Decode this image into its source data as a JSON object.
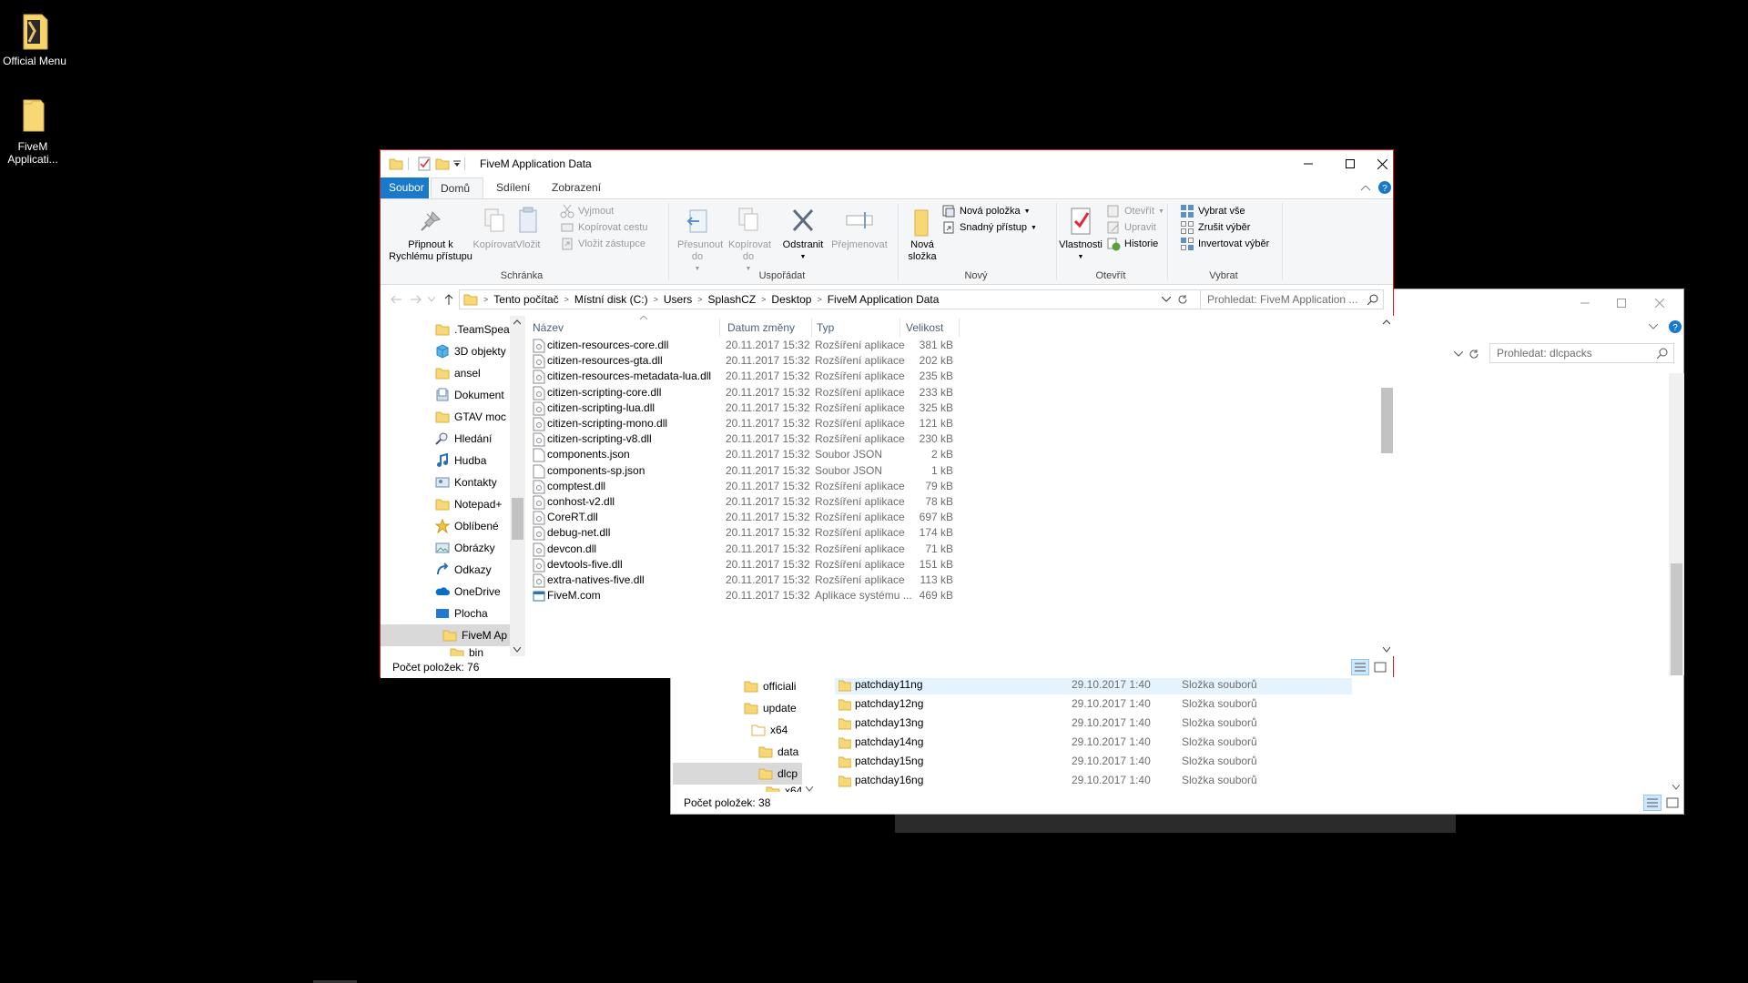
{
  "desktop": {
    "icons": [
      {
        "label": "Official Menu",
        "icon": "folder-doc-icon"
      },
      {
        "label": "FiveM Applicati...",
        "icon": "folder-icon"
      }
    ]
  },
  "front_window": {
    "title": "FiveM Application Data",
    "tabs": {
      "file": "Soubor",
      "home": "Domů",
      "share": "Sdílení",
      "view": "Zobrazení"
    },
    "ribbon": {
      "pin": "Připnout k Rychlému přístupu",
      "copy": "Kopírovat",
      "paste": "Vložit",
      "cut": "Vyjmout",
      "copy_path": "Kopírovat cestu",
      "paste_shortcut": "Vložit zástupce",
      "group_clipboard": "Schránka",
      "move_to": "Přesunout do",
      "copy_to": "Kopírovat do",
      "delete": "Odstranit",
      "rename": "Přejmenovat",
      "group_organize": "Uspořádat",
      "new_folder": "Nová složka",
      "new_item": "Nová položka",
      "easy_access": "Snadný přístup",
      "group_new": "Nový",
      "properties": "Vlastnosti",
      "open": "Otevřít",
      "edit": "Upravit",
      "history": "Historie",
      "group_open": "Otevřít",
      "select_all": "Vybrat vše",
      "select_none": "Zrušit výběr",
      "invert_selection": "Invertovat výběr",
      "group_select": "Vybrat"
    },
    "breadcrumb": [
      "Tento počítač",
      "Místní disk (C:)",
      "Users",
      "SplashCZ",
      "Desktop",
      "FiveM Application Data"
    ],
    "search_placeholder": "Prohledat: FiveM Application ...",
    "nav": [
      {
        "label": ".TeamSpea",
        "icon": "folder-icon"
      },
      {
        "label": "3D objekty",
        "icon": "cube-icon"
      },
      {
        "label": "ansel",
        "icon": "folder-icon"
      },
      {
        "label": "Dokument",
        "icon": "documents-icon"
      },
      {
        "label": "GTAV moc",
        "icon": "folder-icon"
      },
      {
        "label": "Hledání",
        "icon": "search-icon"
      },
      {
        "label": "Hudba",
        "icon": "music-icon"
      },
      {
        "label": "Kontakty",
        "icon": "contacts-icon"
      },
      {
        "label": "Notepad+",
        "icon": "folder-icon"
      },
      {
        "label": "Oblíbené",
        "icon": "star-icon"
      },
      {
        "label": "Obrázky",
        "icon": "pictures-icon"
      },
      {
        "label": "Odkazy",
        "icon": "links-icon"
      },
      {
        "label": "OneDrive",
        "icon": "cloud-icon"
      },
      {
        "label": "Plocha",
        "icon": "desktop-icon"
      },
      {
        "label": "FiveM Ap",
        "icon": "folder-icon"
      },
      {
        "label": "bin",
        "icon": "folder-icon"
      }
    ],
    "columns": {
      "name": "Název",
      "date": "Datum změny",
      "type": "Typ",
      "size": "Velikost"
    },
    "files": [
      {
        "name": "citizen-resources-core.dll",
        "date": "20.11.2017 15:32",
        "type": "Rozšíření aplikace",
        "size": "381 kB",
        "icon": "dll-icon"
      },
      {
        "name": "citizen-resources-gta.dll",
        "date": "20.11.2017 15:32",
        "type": "Rozšíření aplikace",
        "size": "202 kB",
        "icon": "dll-icon"
      },
      {
        "name": "citizen-resources-metadata-lua.dll",
        "date": "20.11.2017 15:32",
        "type": "Rozšíření aplikace",
        "size": "235 kB",
        "icon": "dll-icon"
      },
      {
        "name": "citizen-scripting-core.dll",
        "date": "20.11.2017 15:32",
        "type": "Rozšíření aplikace",
        "size": "233 kB",
        "icon": "dll-icon"
      },
      {
        "name": "citizen-scripting-lua.dll",
        "date": "20.11.2017 15:32",
        "type": "Rozšíření aplikace",
        "size": "325 kB",
        "icon": "dll-icon"
      },
      {
        "name": "citizen-scripting-mono.dll",
        "date": "20.11.2017 15:32",
        "type": "Rozšíření aplikace",
        "size": "121 kB",
        "icon": "dll-icon"
      },
      {
        "name": "citizen-scripting-v8.dll",
        "date": "20.11.2017 15:32",
        "type": "Rozšíření aplikace",
        "size": "230 kB",
        "icon": "dll-icon"
      },
      {
        "name": "components.json",
        "date": "20.11.2017 15:32",
        "type": "Soubor JSON",
        "size": "2 kB",
        "icon": "file-icon"
      },
      {
        "name": "components-sp.json",
        "date": "20.11.2017 15:32",
        "type": "Soubor JSON",
        "size": "1 kB",
        "icon": "file-icon"
      },
      {
        "name": "comptest.dll",
        "date": "20.11.2017 15:32",
        "type": "Rozšíření aplikace",
        "size": "79 kB",
        "icon": "dll-icon"
      },
      {
        "name": "conhost-v2.dll",
        "date": "20.11.2017 15:32",
        "type": "Rozšíření aplikace",
        "size": "78 kB",
        "icon": "dll-icon"
      },
      {
        "name": "CoreRT.dll",
        "date": "20.11.2017 15:32",
        "type": "Rozšíření aplikace",
        "size": "697 kB",
        "icon": "dll-icon"
      },
      {
        "name": "debug-net.dll",
        "date": "20.11.2017 15:32",
        "type": "Rozšíření aplikace",
        "size": "174 kB",
        "icon": "dll-icon"
      },
      {
        "name": "devcon.dll",
        "date": "20.11.2017 15:32",
        "type": "Rozšíření aplikace",
        "size": "71 kB",
        "icon": "dll-icon"
      },
      {
        "name": "devtools-five.dll",
        "date": "20.11.2017 15:32",
        "type": "Rozšíření aplikace",
        "size": "151 kB",
        "icon": "dll-icon"
      },
      {
        "name": "extra-natives-five.dll",
        "date": "20.11.2017 15:32",
        "type": "Rozšíření aplikace",
        "size": "113 kB",
        "icon": "dll-icon"
      },
      {
        "name": "FiveM.com",
        "date": "20.11.2017 15:32",
        "type": "Aplikace systému ...",
        "size": "469 kB",
        "icon": "app-icon"
      }
    ],
    "status": "Počet položek: 76"
  },
  "back_window": {
    "search_placeholder": "Prohledat: dlcpacks",
    "nav": [
      {
        "label": "officiali",
        "icon": "folder-icon"
      },
      {
        "label": "update",
        "icon": "folder-icon"
      },
      {
        "label": "x64",
        "icon": "folder-icon"
      },
      {
        "label": "data",
        "icon": "folder-icon"
      },
      {
        "label": "dlcp",
        "icon": "folder-icon"
      },
      {
        "label": "x64",
        "icon": "folder-icon"
      }
    ],
    "files": [
      {
        "name": "patchday11ng",
        "date": "29.10.2017 1:40",
        "type": "Složka souborů"
      },
      {
        "name": "patchday12ng",
        "date": "29.10.2017 1:40",
        "type": "Složka souborů"
      },
      {
        "name": "patchday13ng",
        "date": "29.10.2017 1:40",
        "type": "Složka souborů"
      },
      {
        "name": "patchday14ng",
        "date": "29.10.2017 1:40",
        "type": "Složka souborů"
      },
      {
        "name": "patchday15ng",
        "date": "29.10.2017 1:40",
        "type": "Složka souborů"
      },
      {
        "name": "patchday16ng",
        "date": "29.10.2017 1:40",
        "type": "Složka souborů"
      }
    ],
    "status": "Počet položek: 38"
  },
  "colors": {
    "accent": "#1979ca",
    "window_border": "#e81123",
    "folder": "#f8d775",
    "selection": "#cce8ff"
  }
}
